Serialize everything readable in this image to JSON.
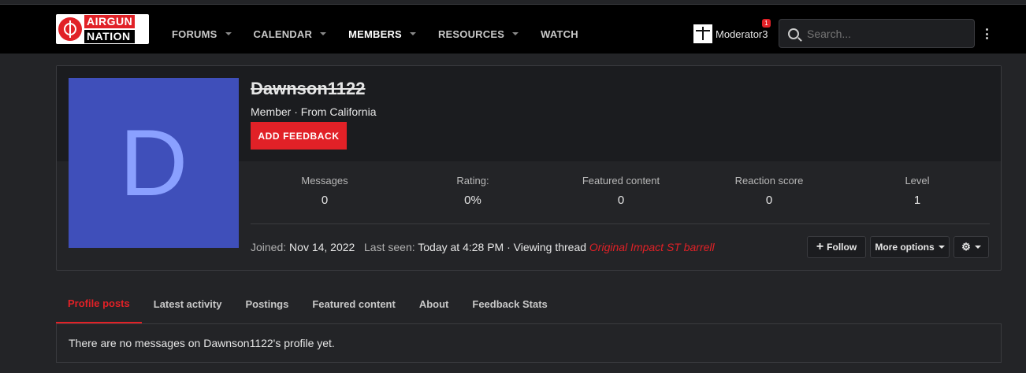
{
  "logo": {
    "line1": "AIRGUN",
    "line2": "NATION"
  },
  "nav": [
    {
      "label": "FORUMS",
      "dropdown": true,
      "active": false
    },
    {
      "label": "CALENDAR",
      "dropdown": true,
      "active": false
    },
    {
      "label": "MEMBERS",
      "dropdown": true,
      "active": true
    },
    {
      "label": "RESOURCES",
      "dropdown": true,
      "active": false
    },
    {
      "label": "WATCH",
      "dropdown": false,
      "active": false
    }
  ],
  "user": {
    "name": "Moderator3",
    "badge": "1"
  },
  "search": {
    "placeholder": "Search..."
  },
  "profile": {
    "username": "Dawnson1122",
    "avatar_letter": "D",
    "subtitle": "Member · From California",
    "feedback_button": "ADD FEEDBACK",
    "stats": [
      {
        "label": "Messages",
        "value": "0"
      },
      {
        "label": "Rating:",
        "value": "0%"
      },
      {
        "label": "Featured content",
        "value": "0"
      },
      {
        "label": "Reaction score",
        "value": "0"
      },
      {
        "label": "Level",
        "value": "1"
      }
    ],
    "joined_label": "Joined:",
    "joined_value": "Nov 14, 2022",
    "last_seen_label": "Last seen:",
    "last_seen_value": "Today at 4:28 PM · Viewing thread",
    "thread_link": "Original Impact ST barrell",
    "follow_button": "Follow",
    "more_options_button": "More options"
  },
  "tabs": [
    {
      "label": "Profile posts",
      "active": true
    },
    {
      "label": "Latest activity",
      "active": false
    },
    {
      "label": "Postings",
      "active": false
    },
    {
      "label": "Featured content",
      "active": false
    },
    {
      "label": "About",
      "active": false
    },
    {
      "label": "Feedback Stats",
      "active": false
    }
  ],
  "empty_message": "There are no messages on Dawnson1122's profile yet.",
  "colors": {
    "accent": "#e12127",
    "avatar_bg": "#3f4fba",
    "avatar_letter": "#8aa0ff"
  }
}
